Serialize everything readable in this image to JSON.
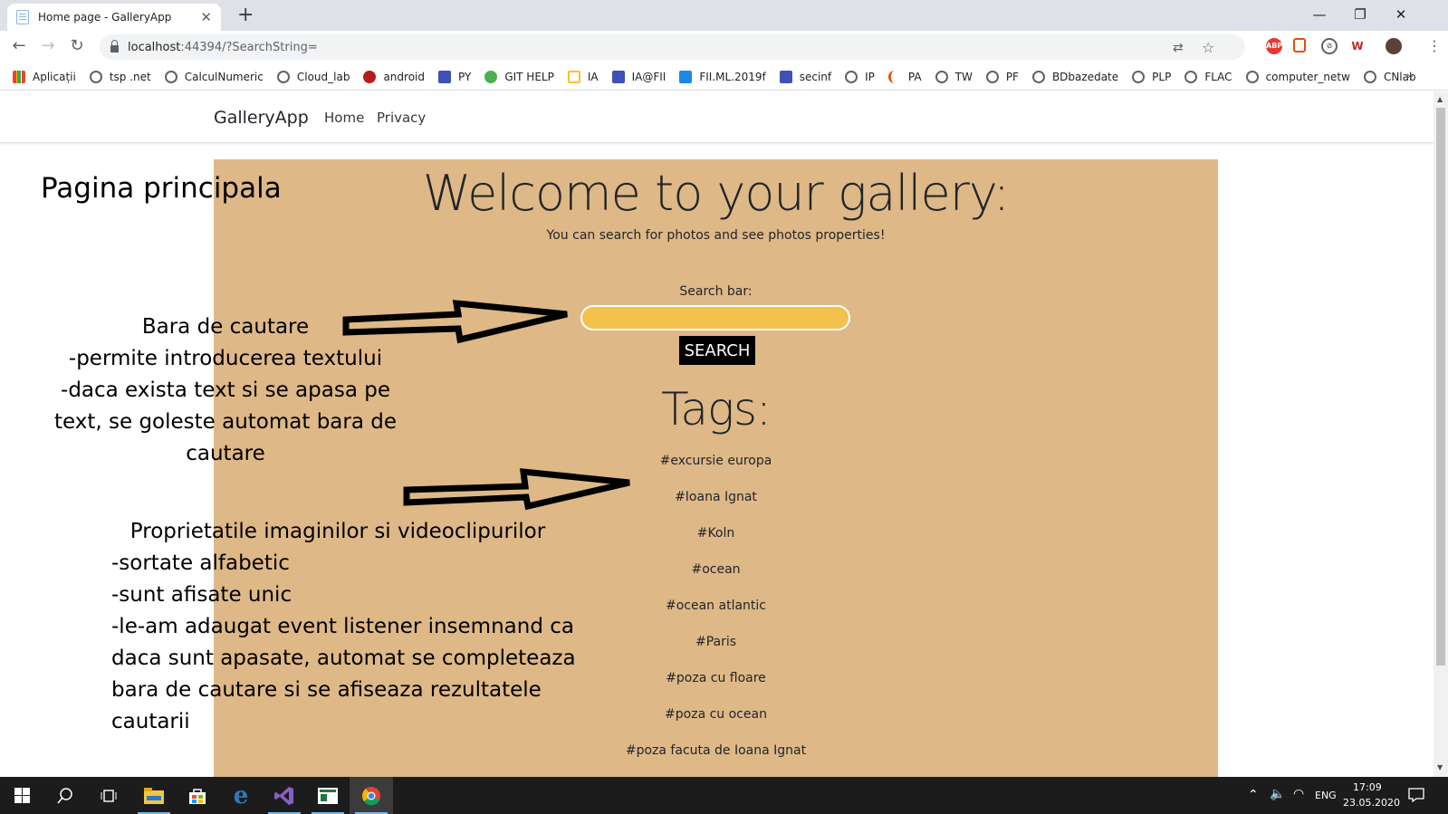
{
  "browser": {
    "tab_title": "Home page - GalleryApp",
    "new_tab": "+",
    "close": "✕",
    "minimize": "—",
    "restore": "❐",
    "window_close": "✕",
    "url_host": "localhost",
    "url_rest": ":44394/?SearchString=",
    "bookmarks": [
      {
        "label": "Aplicații",
        "color": "#4285f4"
      },
      {
        "label": "tsp .net",
        "color": "#5f6368"
      },
      {
        "label": "CalculNumeric",
        "color": "#5f6368"
      },
      {
        "label": "Cloud_lab",
        "color": "#5f6368"
      },
      {
        "label": "android",
        "color": "#b71c1c"
      },
      {
        "label": "PY",
        "color": "#3f51b5"
      },
      {
        "label": "GIT HELP",
        "color": "#4caf50"
      },
      {
        "label": "IA",
        "color": "#fbc02d"
      },
      {
        "label": "IA@FII",
        "color": "#3f51b5"
      },
      {
        "label": "FII.ML.2019f",
        "color": "#1e88e5"
      },
      {
        "label": "secinf",
        "color": "#3f51b5"
      },
      {
        "label": "IP",
        "color": "#5f6368"
      },
      {
        "label": "PA",
        "color": "#e65100"
      },
      {
        "label": "TW",
        "color": "#5f6368"
      },
      {
        "label": "PF",
        "color": "#5f6368"
      },
      {
        "label": "BDbazedate",
        "color": "#5f6368"
      },
      {
        "label": "PLP",
        "color": "#5f6368"
      },
      {
        "label": "FLAC",
        "color": "#5f6368"
      },
      {
        "label": "computer_netw",
        "color": "#5f6368"
      },
      {
        "label": "CNlab",
        "color": "#5f6368"
      }
    ],
    "more": "»"
  },
  "site": {
    "brand": "GalleryApp",
    "nav": [
      "Home",
      "Privacy"
    ]
  },
  "page": {
    "heading": "Pagina principala",
    "welcome": "Welcome to your gallery:",
    "subtitle": "You can search for photos and see photos properties!",
    "search_label": "Search bar:",
    "search_value": "",
    "search_button": "SEARCH",
    "tags_title": "Tags:",
    "tags": [
      "#excursie europa",
      "#Ioana Ignat",
      "#Koln",
      "#ocean",
      "#ocean atlantic",
      "#Paris",
      "#poza cu floare",
      "#poza cu ocean",
      "#poza facuta de Ioana Ignat"
    ],
    "background_color": "#deb887",
    "input_color": "#f2c14e"
  },
  "annotations": {
    "search_note": [
      "Bara de cautare",
      "-permite introducerea textului",
      "-daca exista text si se apasa pe text, se goleste automat bara de cautare"
    ],
    "props_note": [
      "Proprietatile imaginilor si videoclipurilor",
      "-sortate alfabetic",
      "-sunt afisate unic",
      "-le-am adaugat event listener insemnand ca daca sunt apasate, automat se completeaza bara de cautare si se afiseaza rezultatele cautarii"
    ]
  },
  "taskbar": {
    "lang": "ENG",
    "time": "17:09",
    "date": "23.05.2020"
  }
}
